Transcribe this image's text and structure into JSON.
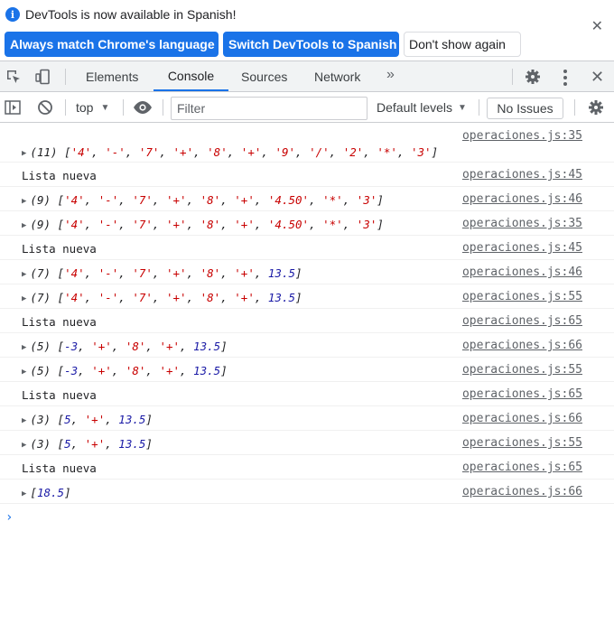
{
  "infobar": {
    "message": "DevTools is now available in Spanish!",
    "buttons": {
      "match_language": "Always match Chrome's language",
      "switch_spanish": "Switch DevTools to Spanish",
      "dont_show": "Don't show again"
    }
  },
  "tabs": [
    {
      "label": "Elements",
      "active": false
    },
    {
      "label": "Console",
      "active": true
    },
    {
      "label": "Sources",
      "active": false
    },
    {
      "label": "Network",
      "active": false
    }
  ],
  "toolbar": {
    "context": "top",
    "filter_placeholder": "Filter",
    "levels": "Default levels",
    "issues": "No Issues"
  },
  "console": [
    {
      "source": "operaciones.js:35",
      "type": "array",
      "count": "(11)",
      "items": [
        [
          "s",
          "'4'"
        ],
        [
          "s",
          "'-'"
        ],
        [
          "s",
          "'7'"
        ],
        [
          "s",
          "'+'"
        ],
        [
          "s",
          "'8'"
        ],
        [
          "s",
          "'+'"
        ],
        [
          "s",
          "'9'"
        ],
        [
          "s",
          "'/'"
        ],
        [
          "s",
          "'2'"
        ],
        [
          "s",
          "'*'"
        ],
        [
          "s",
          "'3'"
        ]
      ]
    },
    {
      "source": "operaciones.js:45",
      "type": "text",
      "text": "Lista nueva"
    },
    {
      "source": "operaciones.js:46",
      "type": "array",
      "count": "(9)",
      "items": [
        [
          "s",
          "'4'"
        ],
        [
          "s",
          "'-'"
        ],
        [
          "s",
          "'7'"
        ],
        [
          "s",
          "'+'"
        ],
        [
          "s",
          "'8'"
        ],
        [
          "s",
          "'+'"
        ],
        [
          "s",
          "'4.50'"
        ],
        [
          "s",
          "'*'"
        ],
        [
          "s",
          "'3'"
        ]
      ]
    },
    {
      "source": "operaciones.js:35",
      "type": "array",
      "count": "(9)",
      "items": [
        [
          "s",
          "'4'"
        ],
        [
          "s",
          "'-'"
        ],
        [
          "s",
          "'7'"
        ],
        [
          "s",
          "'+'"
        ],
        [
          "s",
          "'8'"
        ],
        [
          "s",
          "'+'"
        ],
        [
          "s",
          "'4.50'"
        ],
        [
          "s",
          "'*'"
        ],
        [
          "s",
          "'3'"
        ]
      ]
    },
    {
      "source": "operaciones.js:45",
      "type": "text",
      "text": "Lista nueva"
    },
    {
      "source": "operaciones.js:46",
      "type": "array",
      "count": "(7)",
      "items": [
        [
          "s",
          "'4'"
        ],
        [
          "s",
          "'-'"
        ],
        [
          "s",
          "'7'"
        ],
        [
          "s",
          "'+'"
        ],
        [
          "s",
          "'8'"
        ],
        [
          "s",
          "'+'"
        ],
        [
          "n",
          "13.5"
        ]
      ]
    },
    {
      "source": "operaciones.js:55",
      "type": "array",
      "count": "(7)",
      "items": [
        [
          "s",
          "'4'"
        ],
        [
          "s",
          "'-'"
        ],
        [
          "s",
          "'7'"
        ],
        [
          "s",
          "'+'"
        ],
        [
          "s",
          "'8'"
        ],
        [
          "s",
          "'+'"
        ],
        [
          "n",
          "13.5"
        ]
      ]
    },
    {
      "source": "operaciones.js:65",
      "type": "text",
      "text": "Lista nueva"
    },
    {
      "source": "operaciones.js:66",
      "type": "array",
      "count": "(5)",
      "items": [
        [
          "n",
          "-3"
        ],
        [
          "s",
          "'+'"
        ],
        [
          "s",
          "'8'"
        ],
        [
          "s",
          "'+'"
        ],
        [
          "n",
          "13.5"
        ]
      ]
    },
    {
      "source": "operaciones.js:55",
      "type": "array",
      "count": "(5)",
      "items": [
        [
          "n",
          "-3"
        ],
        [
          "s",
          "'+'"
        ],
        [
          "s",
          "'8'"
        ],
        [
          "s",
          "'+'"
        ],
        [
          "n",
          "13.5"
        ]
      ]
    },
    {
      "source": "operaciones.js:65",
      "type": "text",
      "text": "Lista nueva"
    },
    {
      "source": "operaciones.js:66",
      "type": "array",
      "count": "(3)",
      "items": [
        [
          "n",
          "5"
        ],
        [
          "s",
          "'+'"
        ],
        [
          "n",
          "13.5"
        ]
      ]
    },
    {
      "source": "operaciones.js:55",
      "type": "array",
      "count": "(3)",
      "items": [
        [
          "n",
          "5"
        ],
        [
          "s",
          "'+'"
        ],
        [
          "n",
          "13.5"
        ]
      ]
    },
    {
      "source": "operaciones.js:65",
      "type": "text",
      "text": "Lista nueva"
    },
    {
      "source": "operaciones.js:66",
      "type": "array",
      "count": "",
      "items": [
        [
          "n",
          "18.5"
        ]
      ]
    }
  ],
  "prompt_symbol": "›",
  "colors": {
    "accent": "#1a73e8",
    "string": "#c80000",
    "number": "#1a1aa6"
  }
}
